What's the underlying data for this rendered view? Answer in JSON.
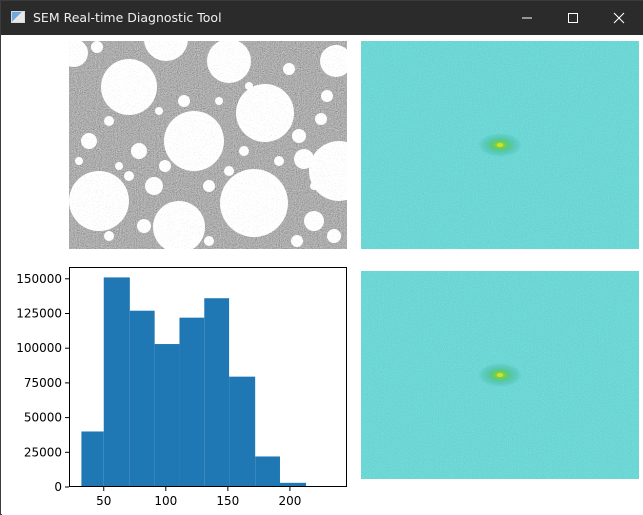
{
  "window": {
    "title": "SEM Real-time Diagnostic Tool",
    "icon": "app-window-icon",
    "controls": [
      "minimize-icon",
      "maximize-icon",
      "close-icon"
    ]
  },
  "panels": {
    "sem_image": {
      "icon": "sem-micrograph",
      "colormap": "gray"
    },
    "fft_top": {
      "icon": "fft-spectrum",
      "colormap": "viridis"
    },
    "fft_bottom": {
      "icon": "fft-spectrum",
      "colormap": "viridis"
    }
  },
  "chart_data": {
    "type": "bar",
    "title": "",
    "xlabel": "",
    "ylabel": "",
    "bins": [
      {
        "x0": 32,
        "x1": 50,
        "value": 40000
      },
      {
        "x0": 50,
        "x1": 71,
        "value": 151000
      },
      {
        "x0": 71,
        "x1": 91,
        "value": 127000
      },
      {
        "x0": 91,
        "x1": 111,
        "value": 103000
      },
      {
        "x0": 111,
        "x1": 131,
        "value": 122000
      },
      {
        "x0": 131,
        "x1": 151,
        "value": 136000
      },
      {
        "x0": 151,
        "x1": 172,
        "value": 79500
      },
      {
        "x0": 172,
        "x1": 192,
        "value": 22000
      },
      {
        "x0": 192,
        "x1": 213,
        "value": 3000
      },
      {
        "x0": 213,
        "x1": 233,
        "value": 200
      }
    ],
    "xlim": [
      22,
      246
    ],
    "ylim": [
      0,
      158500
    ],
    "xticks": [
      50,
      100,
      150,
      200
    ],
    "xtick_labels": [
      "50",
      "100",
      "150",
      "200"
    ],
    "yticks": [
      0,
      25000,
      50000,
      75000,
      100000,
      125000,
      150000
    ],
    "ytick_labels": [
      "0",
      "25000",
      "50000",
      "75000",
      "100000",
      "125000",
      "150000"
    ],
    "bar_color": "#1f77b4",
    "grid": false,
    "legend": "none"
  }
}
